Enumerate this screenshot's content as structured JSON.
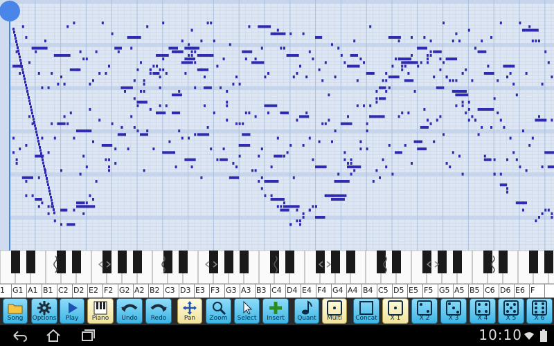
{
  "toolbar": {
    "buttons": [
      {
        "id": "song",
        "label": "Song",
        "icon": "folder-icon",
        "active": false
      },
      {
        "id": "options",
        "label": "Options",
        "icon": "gear-icon",
        "active": false
      },
      {
        "id": "play",
        "label": "Play",
        "icon": "play-icon",
        "active": false
      },
      {
        "id": "piano",
        "label": "Piano",
        "icon": "piano-icon",
        "active": true
      },
      {
        "id": "undo",
        "label": "Undo",
        "icon": "undo-arrow-icon",
        "active": false
      },
      {
        "id": "redo",
        "label": "Redo",
        "icon": "redo-arrow-icon",
        "active": false
      },
      {
        "id": "pan",
        "label": "Pan",
        "icon": "move-cross-icon",
        "active": true
      },
      {
        "id": "zoom",
        "label": "Zoom",
        "icon": "magnifier-icon",
        "active": false
      },
      {
        "id": "select",
        "label": "Select",
        "icon": "cursor-icon",
        "active": false
      },
      {
        "id": "insert",
        "label": "Insert",
        "icon": "plus-icon",
        "active": false
      },
      {
        "id": "quant",
        "label": "Quant",
        "icon": "note-icon",
        "active": false
      },
      {
        "id": "multi",
        "label": "Multi",
        "icon": "dice-1-icon",
        "active": true
      },
      {
        "id": "concat",
        "label": "Concat",
        "icon": "square-icon",
        "active": false
      },
      {
        "id": "x1",
        "label": "X 1",
        "icon": "dice-1-icon",
        "active": true
      },
      {
        "id": "x2",
        "label": "X 2",
        "icon": "dice-2-icon",
        "active": false
      },
      {
        "id": "x3",
        "label": "X 3",
        "icon": "dice-3-icon",
        "active": false
      },
      {
        "id": "x4",
        "label": "X 4",
        "icon": "dice-4-icon",
        "active": false
      },
      {
        "id": "x5",
        "label": "X 5",
        "icon": "dice-5-icon",
        "active": false
      },
      {
        "id": "x6",
        "label": "X 6",
        "icon": "dice-6-icon",
        "active": false
      }
    ]
  },
  "keyboard": {
    "note_labels": [
      "1",
      "G1",
      "A1",
      "B1",
      "C2",
      "D2",
      "E2",
      "F2",
      "G2",
      "A2",
      "B2",
      "C3",
      "D3",
      "E3",
      "F3",
      "G3",
      "A3",
      "B3",
      "C4",
      "D4",
      "E4",
      "F4",
      "G4",
      "A4",
      "B4",
      "C5",
      "D5",
      "E5",
      "F5",
      "G5",
      "A5",
      "B5",
      "C6",
      "D6",
      "E6",
      "F"
    ]
  },
  "navbar": {
    "clock": "10:10",
    "icons": [
      "back-icon",
      "home-icon",
      "recent-apps-icon",
      "wifi-icon",
      "battery-icon"
    ]
  },
  "colors": {
    "grid_background": "#dde6f2",
    "grid_line": "#a9c0de",
    "note": "#2f2ab0",
    "playhead": "#4a86e8",
    "button_blue": "#3db5e6",
    "button_active": "#f1e29b"
  }
}
